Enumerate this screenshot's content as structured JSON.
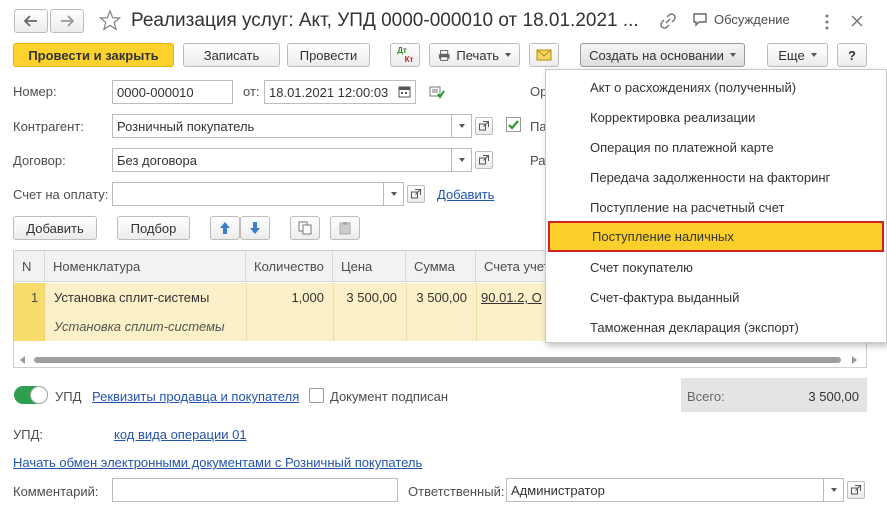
{
  "window": {
    "title": "Реализация услуг: Акт, УПД 0000-000010 от 18.01.2021 ...",
    "discussion_label": "Обсуждение"
  },
  "toolbar": {
    "post_close": "Провести и закрыть",
    "save": "Записать",
    "post": "Провести",
    "dtkt_top": "Дт",
    "dtkt_bottom": "Кт",
    "print": "Печать",
    "create_based": "Создать на основании",
    "more": "Еще",
    "help": "?"
  },
  "form": {
    "number_label": "Номер:",
    "number_value": "0000-000010",
    "from_label": "от:",
    "date_value": "18.01.2021 12:00:03",
    "org_label_partial": "Ор",
    "counterparty_label": "Контрагент:",
    "counterparty_value": "Розничный покупатель",
    "pa_partial": "Па",
    "contract_label": "Договор:",
    "contract_value": "Без договора",
    "ra_partial": "Ра",
    "invoice_label": "Счет на оплату:",
    "invoice_value": "",
    "add_link": "Добавить"
  },
  "table_toolbar": {
    "add": "Добавить",
    "pick": "Подбор"
  },
  "table": {
    "headers": [
      "N",
      "Номенклатура",
      "Количество",
      "Цена",
      "Сумма",
      "Счета учет"
    ],
    "row": {
      "n": "1",
      "item": "Установка сплит-системы",
      "content": "Установка сплит-системы",
      "qty": "1,000",
      "price": "3 500,00",
      "sum": "3 500,00",
      "account": "90.01.2,  О"
    }
  },
  "footer": {
    "upd_label": "УПД",
    "seller_buyer_link": "Реквизиты продавца и покупателя",
    "signed_label": "Документ подписан",
    "total_label": "Всего:",
    "total_value": "3 500,00",
    "upd_field_label": "УПД:",
    "op_code_link": "код вида операции 01",
    "edo_link": "Начать обмен электронными документами с Розничный покупатель",
    "comment_label": "Комментарий:",
    "comment_value": "",
    "responsible_label": "Ответственный:",
    "responsible_value": "Администратор"
  },
  "dropdown_menu": {
    "items": [
      "Акт о расхождениях (полученный)",
      "Корректировка реализации",
      "Операция по платежной карте",
      "Передача задолженности на факторинг",
      "Поступление на расчетный счет",
      "Поступление наличных",
      "Счет покупателю",
      "Счет-фактура выданный",
      "Таможенная декларация (экспорт)"
    ],
    "selected_index": 5
  },
  "colors": {
    "accent_yellow": "#fdd22f",
    "row_highlight": "#fbf0c8",
    "link": "#2255aa",
    "selected_border": "#d42020",
    "toggle_green": "#2e9e4f"
  }
}
